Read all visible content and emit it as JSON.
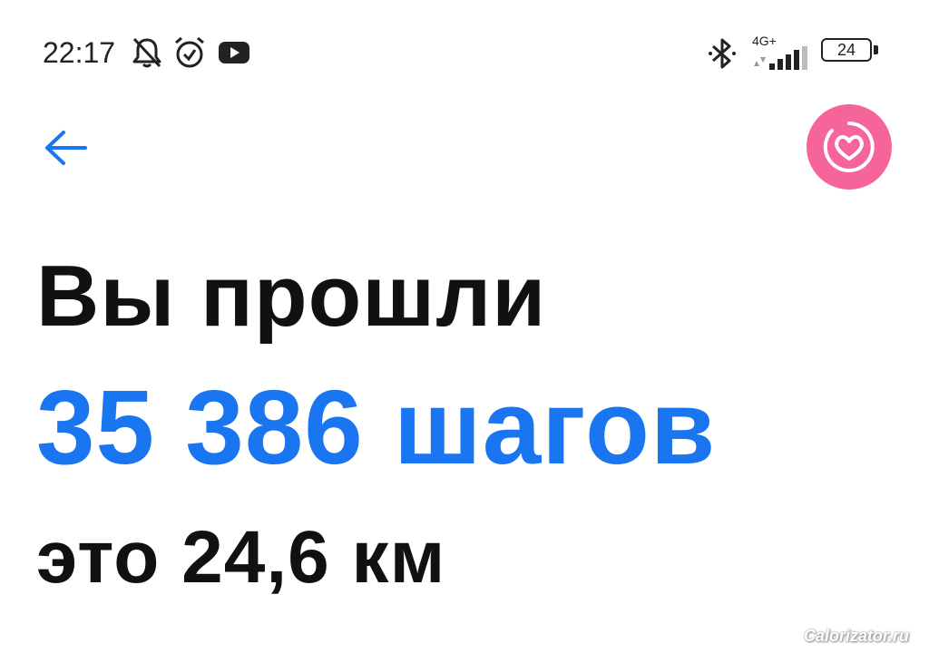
{
  "status_bar": {
    "time": "22:17",
    "network": "4G+",
    "battery": "24",
    "icons": [
      "notifications-muted-icon",
      "alarm-icon",
      "youtube-icon",
      "bluetooth-icon",
      "signal-icon",
      "battery-icon"
    ]
  },
  "header": {
    "back_icon": "arrow-left-icon",
    "health_icon": "heart-ring-icon"
  },
  "main": {
    "line1": "Вы прошли",
    "line2": "35 386 шагов",
    "line3": "это 24,6 км"
  },
  "watermark": "Calorizator.ru",
  "colors": {
    "accent_blue": "#1a75f0",
    "health_pink": "#f5659a",
    "text_dark": "#111111"
  }
}
